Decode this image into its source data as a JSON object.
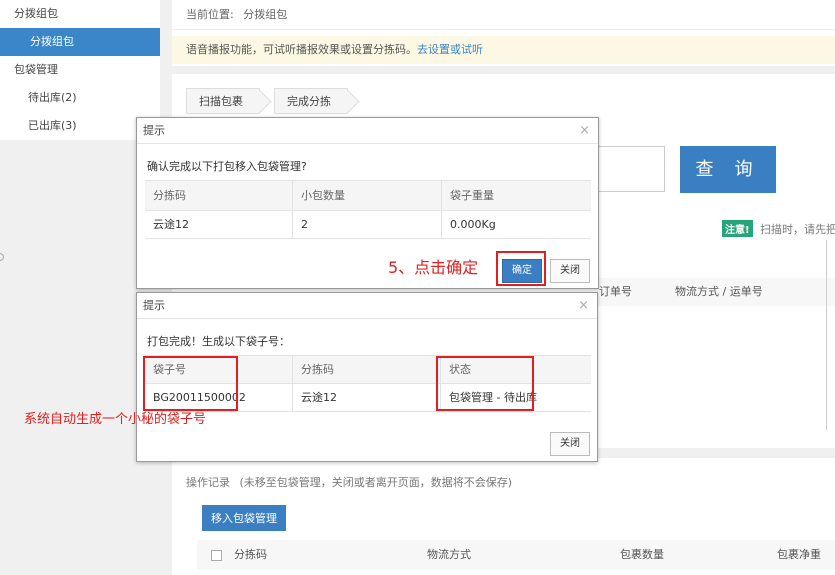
{
  "sidebar": {
    "items": [
      {
        "label": "分拨组包"
      },
      {
        "label": "分拨组包"
      },
      {
        "label": "包袋管理"
      },
      {
        "label": "待出库(2)"
      },
      {
        "label": "已出库(3)"
      }
    ]
  },
  "breadcrumb": {
    "prefix": "当前位置:",
    "current": "分拨组包"
  },
  "notice": {
    "text": "语音播报功能，可试听播报效果或设置分拣码。",
    "link": "去设置或试听"
  },
  "steps": [
    "扫描包裹",
    "完成分拣"
  ],
  "query_button": "查 询",
  "warning": {
    "tag": "注意!",
    "text": "扫描时，请先把"
  },
  "list_headers": [
    "订单号",
    "物流方式 / 运单号"
  ],
  "operation_log": {
    "title": "操作记录",
    "note": "(未移至包袋管理，关闭或者离开页面，数据将不会保存)"
  },
  "move_button": "移入包袋管理",
  "table_headers": [
    "分拣码",
    "物流方式",
    "包裹数量",
    "包裹净重"
  ],
  "dialog_confirm": {
    "title": "提示",
    "message": "确认完成以下打包移入包袋管理?",
    "columns": [
      "分拣码",
      "小包数量",
      "袋子重量"
    ],
    "row": [
      "云途12",
      "2",
      "0.000Kg"
    ],
    "ok": "确定",
    "close": "关闭"
  },
  "dialog_result": {
    "title": "提示",
    "message": "打包完成！生成以下袋子号：",
    "columns": [
      "袋子号",
      "分拣码",
      "状态"
    ],
    "row": [
      "BG20011500002",
      "云途12",
      "包袋管理 - 待出库"
    ],
    "close": "关闭"
  },
  "annotations": {
    "step5": "5、点击确定",
    "bag_no": "系统自动生成一个小秘的袋子号"
  },
  "colors": {
    "primary": "#3a7fc1",
    "annotation": "#e02020",
    "success_tag": "#27a57a"
  }
}
